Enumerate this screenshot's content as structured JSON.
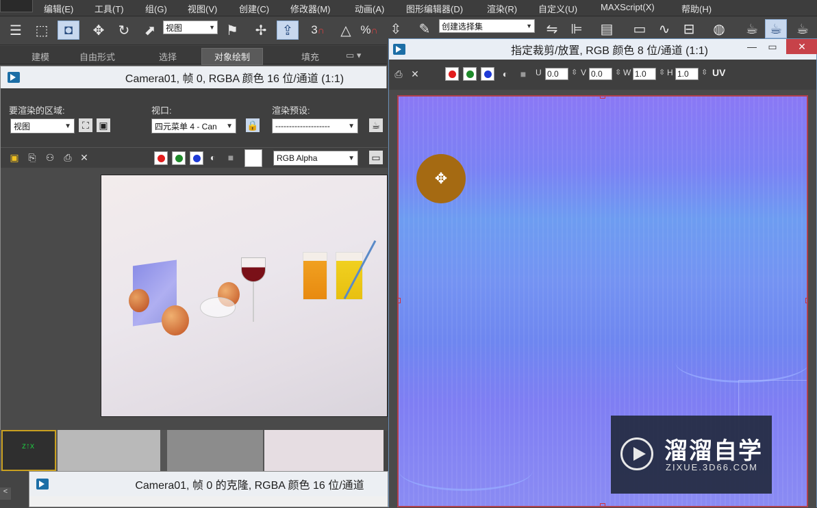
{
  "menubar": {
    "items": [
      "编辑(E)",
      "工具(T)",
      "组(G)",
      "视图(V)",
      "创建(C)",
      "修改器(M)",
      "动画(A)",
      "图形编辑器(D)",
      "渲染(R)",
      "自定义(U)",
      "MAXScript(X)",
      "帮助(H)"
    ]
  },
  "toolbar": {
    "view_dropdown": "视图",
    "selection_set_dropdown": "创建选择集",
    "snap_3": "3",
    "percent_snap": "%"
  },
  "ribbon": {
    "tabs": [
      "建模",
      "自由形式",
      "选择",
      "对象绘制",
      "填充"
    ]
  },
  "render_window": {
    "title": "Camera01, 帧 0, RGBA 颜色 16 位/通道 (1:1)",
    "area_label": "要渲染的区域:",
    "area_value": "视图",
    "viewport_label": "视口:",
    "viewport_value": "四元菜单 4 - Can",
    "preset_label": "渲染预设:",
    "preset_value": "--------------------",
    "channel_value": "RGB Alpha"
  },
  "crop_window": {
    "title": "指定裁剪/放置, RGB 颜色 8 位/通道 (1:1)",
    "u_label": "U",
    "u_value": "0.0",
    "v_label": "V",
    "v_value": "0.0",
    "w_label": "W",
    "w_value": "1.0",
    "h_label": "H",
    "h_value": "1.0",
    "uv_label": "UV"
  },
  "clone_window": {
    "title": "Camera01, 帧 0 的克隆, RGBA 颜色 16 位/通道"
  },
  "watermark": {
    "brand": "溜溜自学",
    "url": "ZIXUE.3D66.COM"
  },
  "colors": {
    "red": "#e21d1d",
    "green": "#1e8a2a",
    "blue": "#1f3bd6"
  }
}
